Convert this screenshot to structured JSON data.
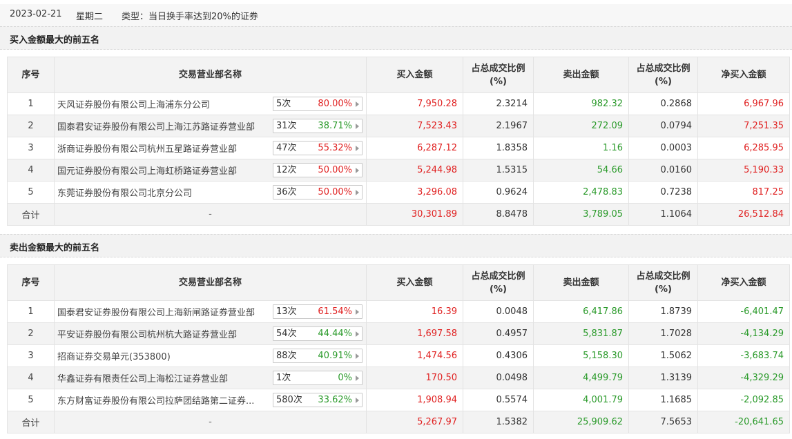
{
  "header": {
    "date": "2023-02-21",
    "weekday": "星期二",
    "type_text": "类型：当日换手率达到20%的证券"
  },
  "columns": {
    "idx": "序号",
    "name": "交易营业部名称",
    "buy": "买入金额",
    "buy_ratio": "占总成交比例(%)",
    "sell": "卖出金额",
    "sell_ratio": "占总成交比例(%)",
    "net": "净买入金额"
  },
  "colors": {
    "positive": "#e02020",
    "negative": "#2a9a2a"
  },
  "buy_top5": {
    "title": "买入金额最大的前五名",
    "rows": [
      {
        "idx": "1",
        "name": "天风证券股份有限公司上海浦东分公司",
        "count": "5次",
        "pct": "80.00%",
        "pct_color": "red",
        "buy": "7,950.28",
        "buy_ratio": "2.3214",
        "sell": "982.32",
        "sell_ratio": "0.2868",
        "net": "6,967.96",
        "net_color": "red"
      },
      {
        "idx": "2",
        "name": "国泰君安证券股份有限公司上海江苏路证券营业部",
        "count": "31次",
        "pct": "38.71%",
        "pct_color": "green",
        "buy": "7,523.43",
        "buy_ratio": "2.1967",
        "sell": "272.09",
        "sell_ratio": "0.0794",
        "net": "7,251.35",
        "net_color": "red"
      },
      {
        "idx": "3",
        "name": "浙商证券股份有限公司杭州五星路证券营业部",
        "count": "47次",
        "pct": "55.32%",
        "pct_color": "red",
        "buy": "6,287.12",
        "buy_ratio": "1.8358",
        "sell": "1.16",
        "sell_ratio": "0.0003",
        "net": "6,285.95",
        "net_color": "red"
      },
      {
        "idx": "4",
        "name": "国元证券股份有限公司上海虹桥路证券营业部",
        "count": "12次",
        "pct": "50.00%",
        "pct_color": "red",
        "buy": "5,244.98",
        "buy_ratio": "1.5315",
        "sell": "54.66",
        "sell_ratio": "0.0160",
        "net": "5,190.33",
        "net_color": "red"
      },
      {
        "idx": "5",
        "name": "东莞证券股份有限公司北京分公司",
        "count": "36次",
        "pct": "50.00%",
        "pct_color": "red",
        "buy": "3,296.08",
        "buy_ratio": "0.9624",
        "sell": "2,478.83",
        "sell_ratio": "0.7238",
        "net": "817.25",
        "net_color": "red"
      }
    ],
    "total": {
      "label": "合计",
      "name": "-",
      "buy": "30,301.89",
      "buy_ratio": "8.8478",
      "sell": "3,789.05",
      "sell_ratio": "1.1064",
      "net": "26,512.84",
      "net_color": "red"
    }
  },
  "sell_top5": {
    "title": "卖出金额最大的前五名",
    "rows": [
      {
        "idx": "1",
        "name": "国泰君安证券股份有限公司上海新闸路证券营业部",
        "count": "13次",
        "pct": "61.54%",
        "pct_color": "red",
        "buy": "16.39",
        "buy_ratio": "0.0048",
        "sell": "6,417.86",
        "sell_ratio": "1.8739",
        "net": "-6,401.47",
        "net_color": "green"
      },
      {
        "idx": "2",
        "name": "平安证券股份有限公司杭州杭大路证券营业部",
        "count": "54次",
        "pct": "44.44%",
        "pct_color": "green",
        "buy": "1,697.58",
        "buy_ratio": "0.4957",
        "sell": "5,831.87",
        "sell_ratio": "1.7028",
        "net": "-4,134.29",
        "net_color": "green"
      },
      {
        "idx": "3",
        "name": "招商证券交易单元(353800)",
        "count": "88次",
        "pct": "40.91%",
        "pct_color": "green",
        "buy": "1,474.56",
        "buy_ratio": "0.4306",
        "sell": "5,158.30",
        "sell_ratio": "1.5062",
        "net": "-3,683.74",
        "net_color": "green"
      },
      {
        "idx": "4",
        "name": "华鑫证券有限责任公司上海松江证券营业部",
        "count": "1次",
        "pct": "0%",
        "pct_color": "green",
        "buy": "170.50",
        "buy_ratio": "0.0498",
        "sell": "4,499.79",
        "sell_ratio": "1.3139",
        "net": "-4,329.29",
        "net_color": "green"
      },
      {
        "idx": "5",
        "name": "东方财富证券股份有限公司拉萨团结路第二证券...",
        "count": "580次",
        "pct": "33.62%",
        "pct_color": "green",
        "buy": "1,908.94",
        "buy_ratio": "0.5574",
        "sell": "4,001.79",
        "sell_ratio": "1.1685",
        "net": "-2,092.85",
        "net_color": "green"
      }
    ],
    "total": {
      "label": "合计",
      "name": "-",
      "buy": "5,267.97",
      "buy_ratio": "1.5382",
      "sell": "25,909.62",
      "sell_ratio": "7.5653",
      "net": "-20,641.65",
      "net_color": "green"
    }
  }
}
